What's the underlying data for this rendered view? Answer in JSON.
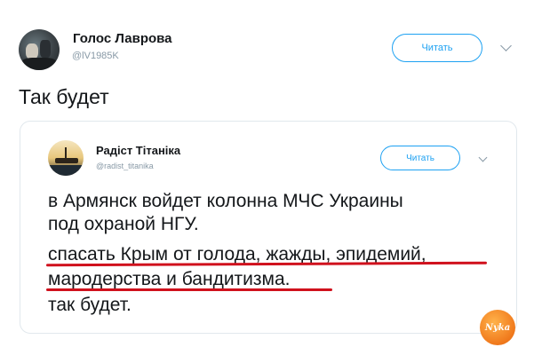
{
  "author": {
    "name": "Голос Лаврова",
    "handle": "@lV1985K",
    "follow_label": "Читать"
  },
  "tweet_text": "Так будет",
  "quoted": {
    "name": "Радіст Тітаніка",
    "handle": "@radist_titanika",
    "follow_label": "Читать",
    "lines": [
      "в Армянск войдет колонна МЧС Украины",
      "под охраной НГУ.",
      "спасать Крым от голода, жажды, эпидемий,",
      "мародерства и бандитизма.",
      "так будет."
    ]
  },
  "watermark_label": "Nyka",
  "colors": {
    "accent": "#1da1f2",
    "underline": "#d0111d",
    "secondary_text": "#8899a6",
    "border": "#e1e8ed"
  },
  "icons": [
    "chevron-down-icon",
    "avatar"
  ]
}
